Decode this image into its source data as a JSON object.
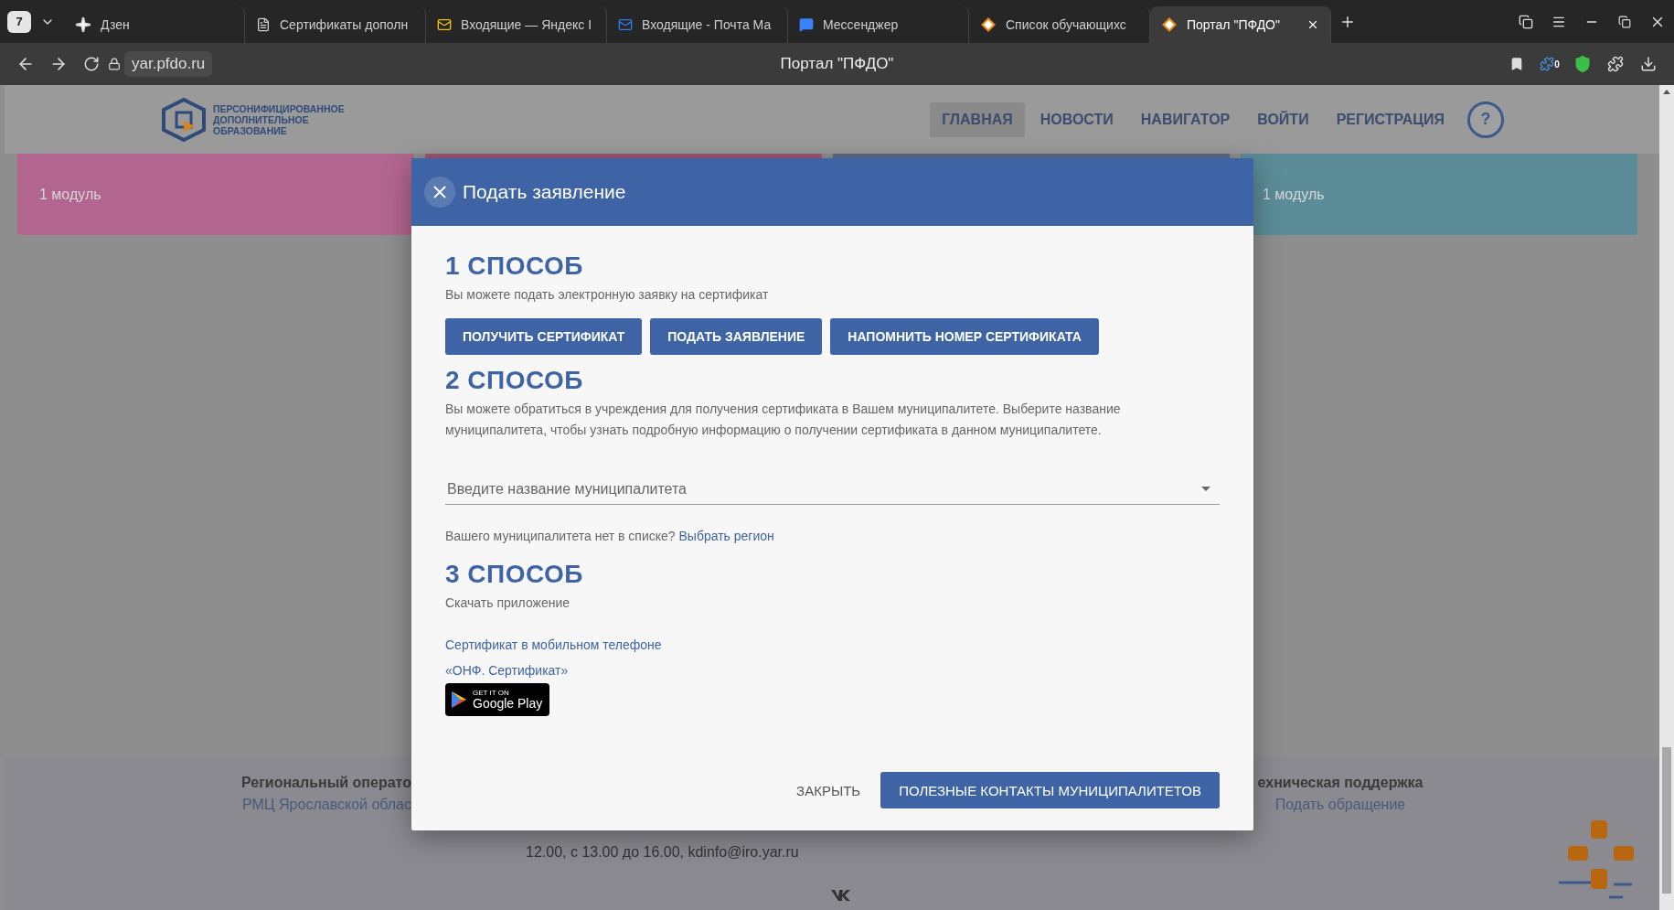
{
  "browser": {
    "tab_count": "7",
    "tabs": [
      {
        "label": "Дзен",
        "kind": "spark",
        "selected": false
      },
      {
        "label": "Сертификаты дополн",
        "kind": "doc",
        "selected": false
      },
      {
        "label": "Входящие — Яндекс I",
        "kind": "mail-yellow",
        "selected": false
      },
      {
        "label": "Входящие - Почта Ма",
        "kind": "mail-blue",
        "selected": false
      },
      {
        "label": "Мессенджер",
        "kind": "chat",
        "selected": false
      },
      {
        "label": "Список обучающихс",
        "kind": "site",
        "selected": false
      },
      {
        "label": "Портал \"ПФДО\"",
        "kind": "site",
        "selected": true
      }
    ],
    "address": "yar.pfdo.ru",
    "page_title": "Портал \"ПФДО\"",
    "extension_badge": "0"
  },
  "site": {
    "logo_lines": [
      "ПЕРСОНИФИЦИРОВАННОЕ",
      "ДОПОЛНИТЕЛЬНОЕ",
      "ОБРАЗОВАНИЕ"
    ],
    "nav": [
      {
        "label": "ГЛАВНАЯ",
        "selected": true
      },
      {
        "label": "НОВОСТИ",
        "selected": false
      },
      {
        "label": "НАВИГАТОР",
        "selected": false
      },
      {
        "label": "ВОЙТИ",
        "selected": false
      },
      {
        "label": "РЕГИСТРАЦИЯ",
        "selected": false
      }
    ],
    "help": "?",
    "cards": [
      {
        "label": "1 модуль",
        "color": "#b2668f"
      },
      {
        "color": "#9e5474"
      },
      {
        "color": "#5e6a8a"
      },
      {
        "label": "1 модуль",
        "color": "#5b8c98"
      }
    ]
  },
  "modal": {
    "title": "Подать заявление",
    "sections": [
      {
        "heading": "1 СПОСОБ",
        "kind": "buttons",
        "text": "Вы можете подать электронную заявку на сертификат",
        "buttons": [
          "ПОЛУЧИТЬ СЕРТИФИКАТ",
          "ПОДАТЬ ЗАЯВЛЕНИЕ",
          "НАПОМНИТЬ НОМЕР СЕРТИФИКАТА"
        ]
      },
      {
        "heading": "2 СПОСОБ",
        "kind": "select",
        "text": "Вы можете обратиться в учреждения для получения сертификата в Вашем муниципалитете. Выберите название муниципалитета, чтобы узнать подробную информацию о получении сертификата в данном муниципалитете.",
        "placeholder": "Введите название муниципалитета",
        "hint": "Вашего муниципалитета нет в списке?",
        "hint_link": "Выбрать регион"
      },
      {
        "heading": "3 СПОСОБ",
        "kind": "app",
        "text": "Скачать приложение",
        "app_lines": [
          "Сертификат в мобильном телефоне",
          "«ОНФ. Сертификат»"
        ],
        "badge_small": "GET IT ON",
        "badge_text": "Google Play"
      }
    ],
    "close_button": "ЗАКРЫТЬ",
    "primary_button": "ПОЛЕЗНЫЕ КОНТАКТЫ МУНИЦИПАЛИТЕТОВ"
  },
  "footer": {
    "left": {
      "title": "Региональный операто",
      "link": "РМЦ Ярославской облас"
    },
    "middle": "12.00, с 13.00 до 16.00, kdinfo@iro.yar.ru",
    "right": {
      "title": "ехническая поддержка",
      "link": "Подать обращение"
    }
  }
}
